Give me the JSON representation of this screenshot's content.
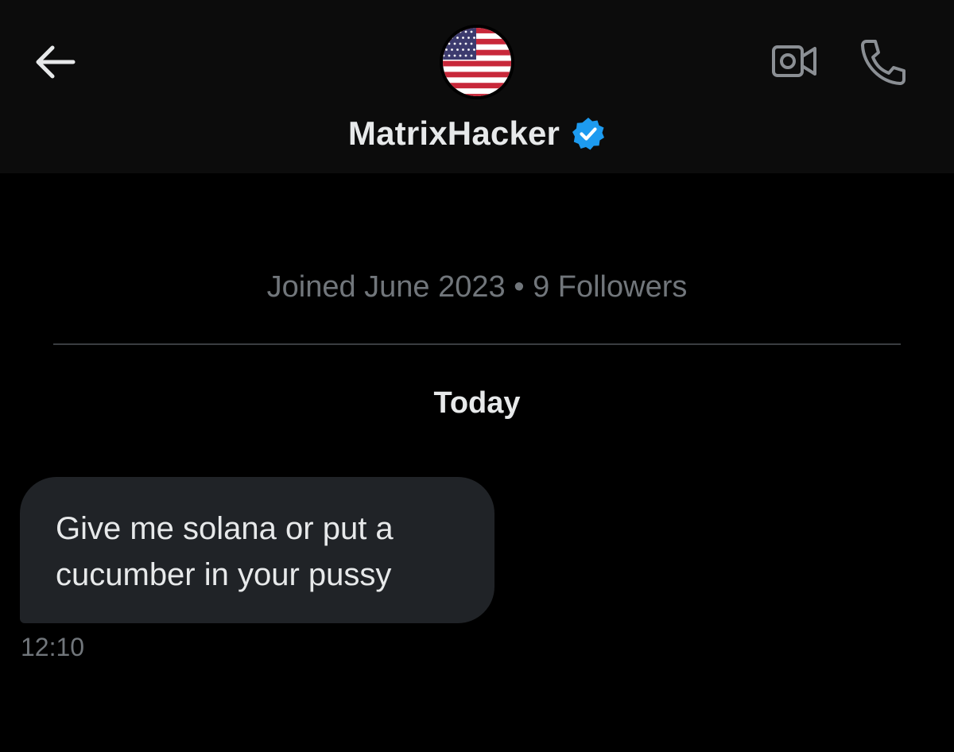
{
  "header": {
    "back_icon": "arrow-left-icon",
    "avatar_icon": "us-flag-avatar",
    "display_name": "MatrixHacker",
    "verified_icon": "verified-badge-icon",
    "verified_color": "#1d9bf0",
    "video_icon": "video-camera-icon",
    "call_icon": "phone-icon"
  },
  "profile": {
    "meta": "Joined June 2023 • 9 Followers"
  },
  "conversation": {
    "day_label": "Today",
    "messages": [
      {
        "direction": "incoming",
        "text": "Give me solana or put a cucumber in your pussy",
        "time": "12:10"
      }
    ]
  },
  "colors": {
    "background": "#000000",
    "header_background": "#0c0c0c",
    "bubble_background": "#202327",
    "primary_text": "#e7e9ea",
    "secondary_text": "#71767b",
    "icon_gray": "#8b8f94"
  }
}
